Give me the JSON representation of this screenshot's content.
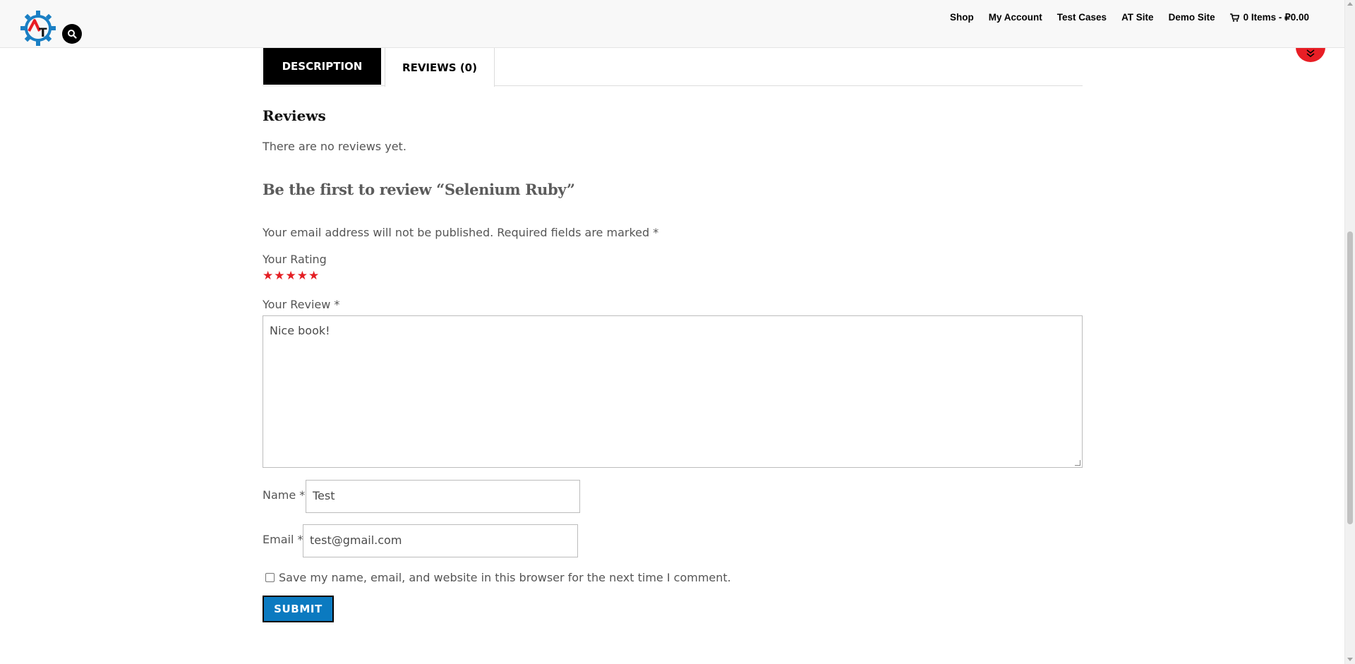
{
  "header": {
    "nav": [
      "Shop",
      "My Account",
      "Test Cases",
      "AT Site",
      "Demo Site"
    ],
    "cart_label": "0 Items - ₽0.00",
    "logo_letter": "T",
    "colors": {
      "logo_blue": "#1a7fc4",
      "logo_red": "#e81e25"
    }
  },
  "tabs": {
    "description": "DESCRIPTION",
    "reviews": "REVIEWS (0)"
  },
  "reviews": {
    "title": "Reviews",
    "empty_text": "There are no reviews yet.",
    "reply_title": "Be the first to review “Selenium Ruby”",
    "notes": "Your email address will not be published. Required fields are marked *",
    "rating_label": "Your Rating",
    "rating_value": 5,
    "rating_max": 5,
    "review_label": "Your Review *",
    "review_value": "Nice book!",
    "name_label": "Name *",
    "name_value": "Test",
    "email_label": "Email *",
    "email_value": "test@gmail.com",
    "consent_label": "Save my name, email, and website in this browser for the next time I comment.",
    "consent_checked": false,
    "submit_label": "SUBMIT"
  },
  "accent_color": "#e41e23",
  "button_color": "#0b7ac0"
}
